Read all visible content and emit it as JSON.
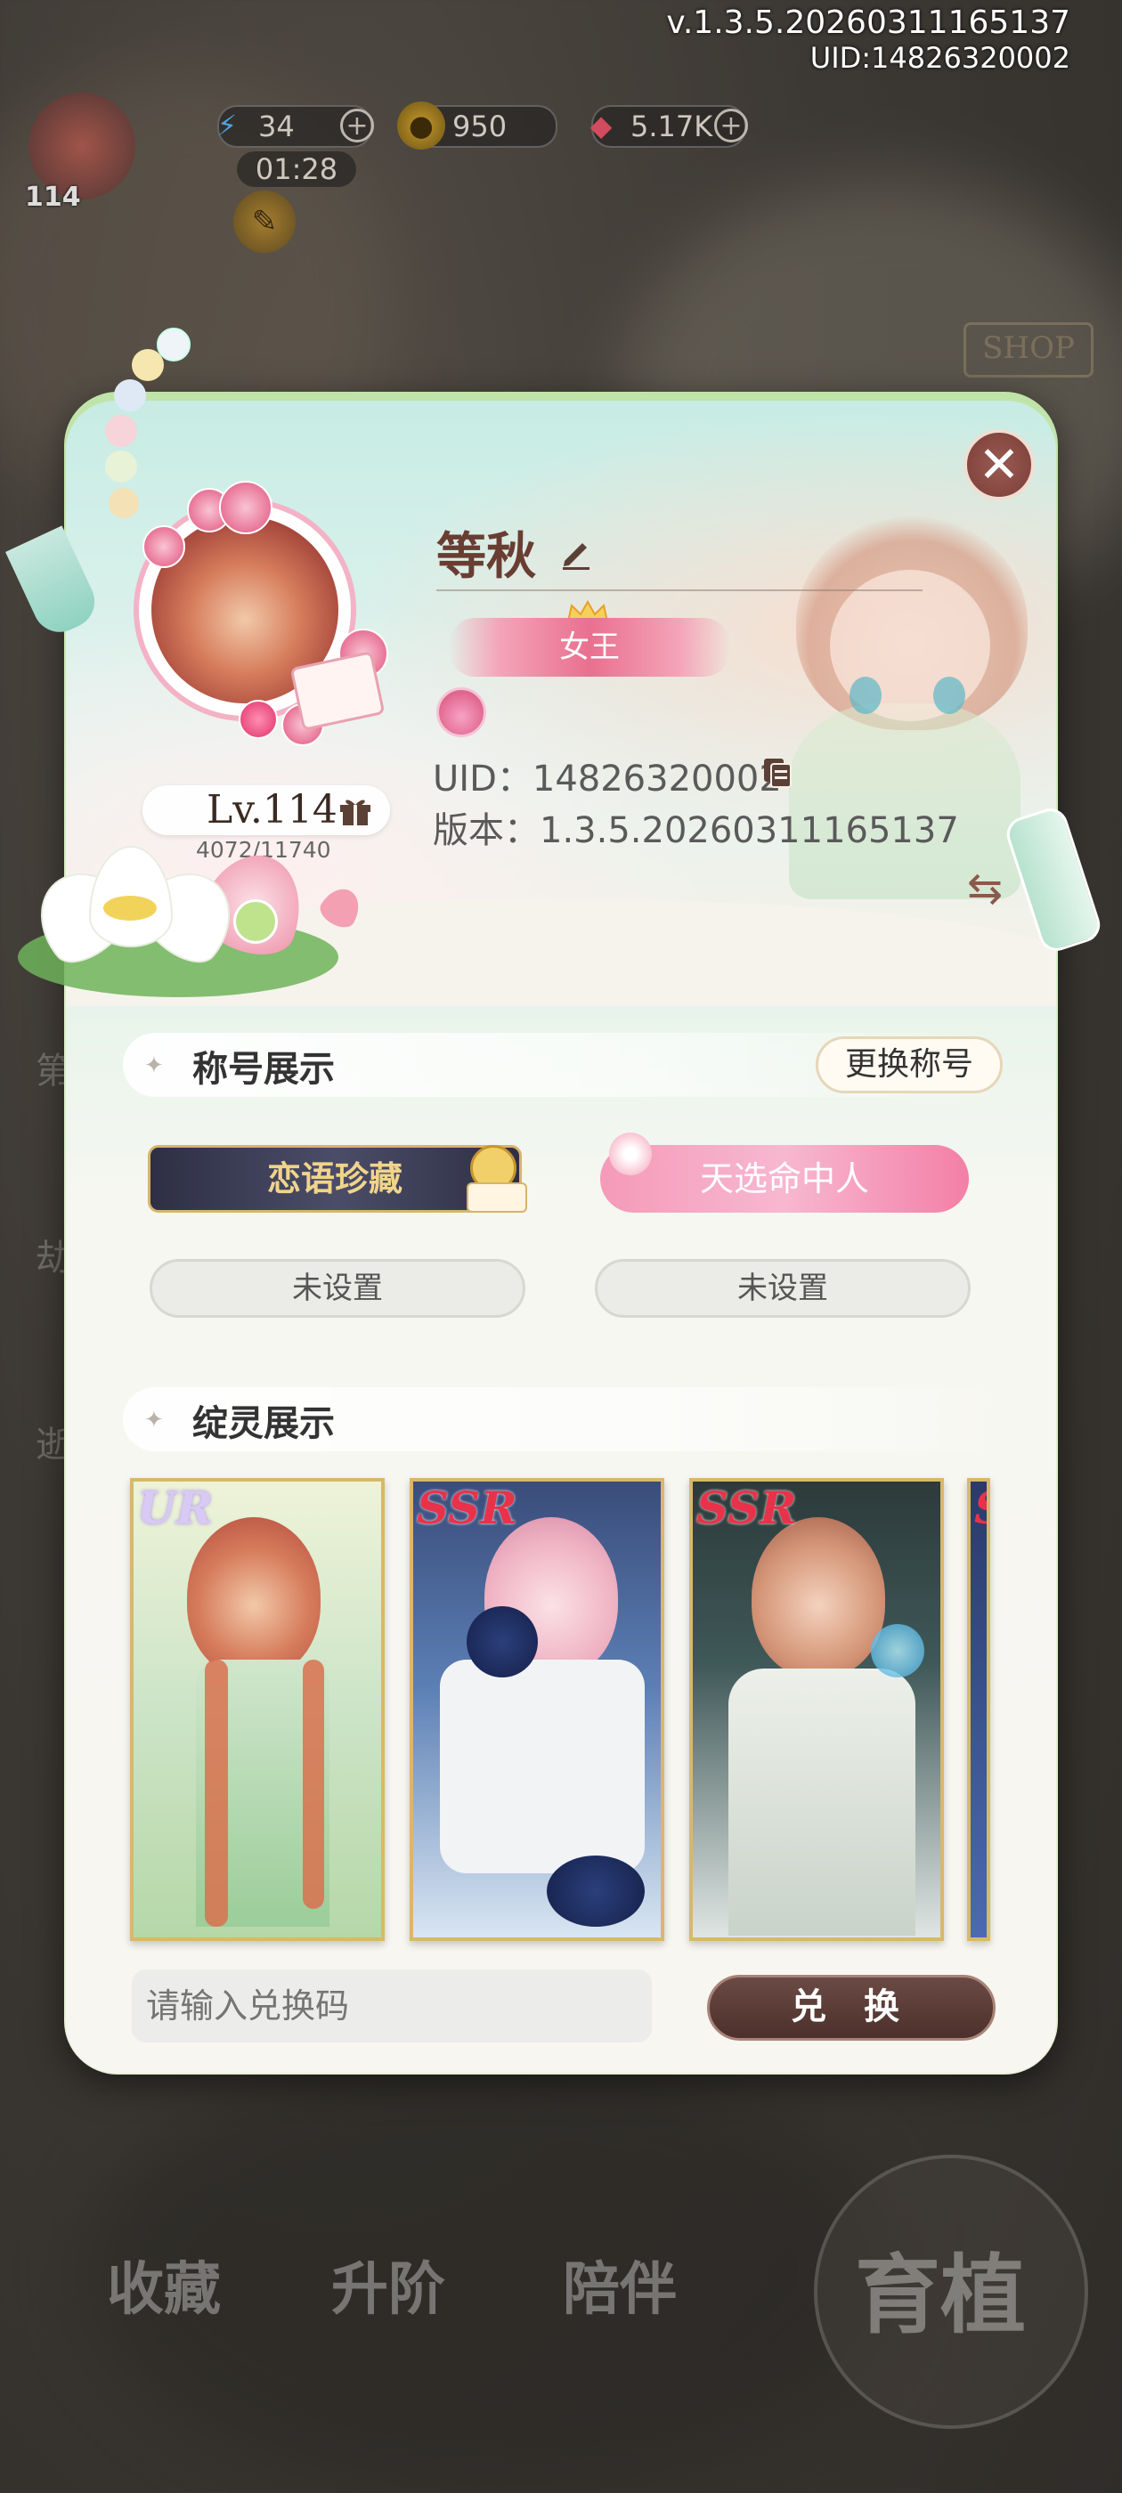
{
  "top_info": {
    "version": "v.1.3.5.20260311165137",
    "uid": "UID:14826320002"
  },
  "resources": {
    "energy": "34",
    "gold": "950",
    "gems": "5.17K",
    "timer": "01:28",
    "player_level_small": "114"
  },
  "background": {
    "shop_sign": "SHOP",
    "nav_collect": "收藏",
    "nav_upgrade": "升阶",
    "nav_accompany": "陪伴",
    "start_label": "育植"
  },
  "profile": {
    "name": "等秋",
    "title_badge": "女王",
    "uid_line": "UID：14826320002",
    "version_line": "版本：1.3.5.20260311165137",
    "level_line": "Lv.114",
    "exp": "4072/11740"
  },
  "titles_section": {
    "heading": "称号展示",
    "change_button": "更换称号",
    "badges": [
      "恋语珍藏",
      "天选命中人"
    ],
    "unset_labels": [
      "未设置",
      "未设置"
    ]
  },
  "cards_section": {
    "heading": "绽灵展示",
    "cards": [
      {
        "rarity": "UR"
      },
      {
        "rarity": "SSR"
      },
      {
        "rarity": "SSR"
      },
      {
        "rarity": "S"
      }
    ]
  },
  "redeem": {
    "placeholder": "请输入兑换码",
    "button": "兑 换"
  },
  "icons": {
    "close": "close-icon",
    "edit": "pencil-icon",
    "gift": "gift-icon",
    "copy": "copy-icon",
    "swap": "swap-icon"
  },
  "colors": {
    "accent_brown": "#6a3d32",
    "pink_badge": "#e9708f",
    "gold_border": "#d9b86a"
  }
}
